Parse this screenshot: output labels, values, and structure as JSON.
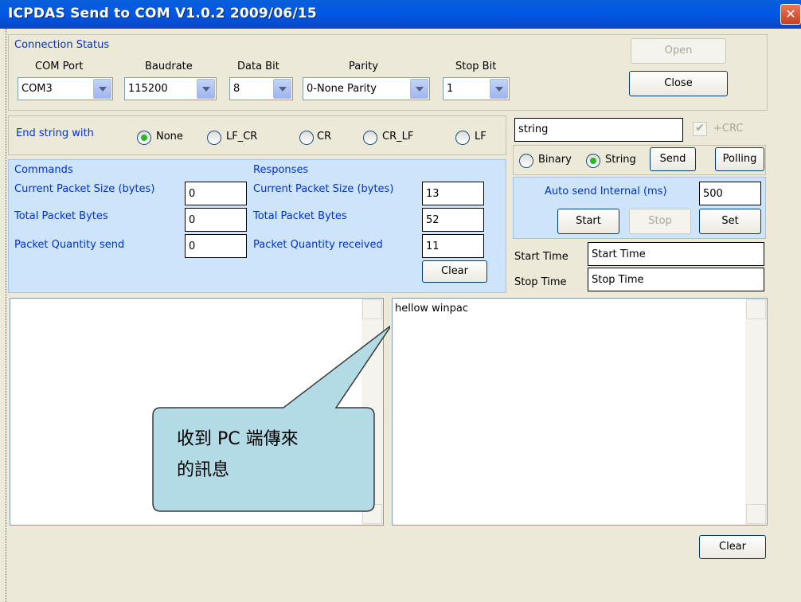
{
  "window": {
    "title": "ICPDAS Send to COM V1.0.2  2009/06/15",
    "close_glyph": "✕"
  },
  "connection": {
    "section_label": "Connection Status",
    "com_port": {
      "label": "COM Port",
      "value": "COM3"
    },
    "baudrate": {
      "label": "Baudrate",
      "value": "115200"
    },
    "data_bit": {
      "label": "Data Bit",
      "value": "8"
    },
    "parity": {
      "label": "Parity",
      "value": "0-None Parity"
    },
    "stop_bit": {
      "label": "Stop Bit",
      "value": "1"
    },
    "open_label": "Open",
    "close_label": "Close"
  },
  "end_string": {
    "label": "End string with",
    "options": [
      "None",
      "LF_CR",
      "CR",
      "CR_LF",
      "LF"
    ],
    "selected": "None"
  },
  "commands": {
    "header": "Commands",
    "packet_size_label": "Current Packet Size (bytes)",
    "packet_size_value": "0",
    "total_bytes_label": "Total Packet Bytes",
    "total_bytes_value": "0",
    "quantity_label": "Packet Quantity send",
    "quantity_value": "0"
  },
  "responses": {
    "header": "Responses",
    "packet_size_label": "Current Packet Size (bytes)",
    "packet_size_value": "13",
    "total_bytes_label": "Total Packet Bytes",
    "total_bytes_value": "52",
    "quantity_label": "Packet Quantity received",
    "quantity_value": "11",
    "clear_label": "Clear"
  },
  "send": {
    "input_value": "string",
    "crc_label": "+CRC",
    "binary_label": "Binary",
    "string_label": "String",
    "mode_selected": "String",
    "send_label": "Send",
    "polling_label": "Polling"
  },
  "auto_send": {
    "label": "Auto send Internal (ms)",
    "value": "500",
    "start_label": "Start",
    "stop_label": "Stop",
    "set_label": "Set"
  },
  "times": {
    "start_label": "Start Time",
    "start_value": "Start Time",
    "stop_label": "Stop Time",
    "stop_value": "Stop Time"
  },
  "receive_box": {
    "text": "hellow winpac"
  },
  "bottom": {
    "clear_label": "Clear"
  },
  "callout": {
    "line1": "收到 PC 端傳來",
    "line2": "的訊息"
  },
  "colors": {
    "accent_blue": "#0033cc",
    "panel_blue": "#cde4fb",
    "callout_fill": "#b3dbe6",
    "radio_on": "#2bb52b"
  }
}
